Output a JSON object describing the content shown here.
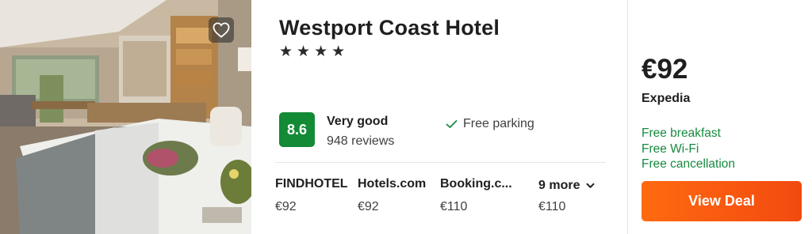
{
  "hotel": {
    "name": "Westport Coast Hotel",
    "stars": [
      "★",
      "★",
      "★",
      "★"
    ]
  },
  "rating": {
    "score": "8.6",
    "label": "Very good",
    "reviews": "948 reviews"
  },
  "amenity": {
    "text": "Free parking"
  },
  "providers": [
    {
      "name": "FINDHOTEL",
      "price": "€92"
    },
    {
      "name": "Hotels.com",
      "price": "€92"
    },
    {
      "name": "Booking.c...",
      "price": "€110"
    }
  ],
  "more": {
    "label": "9 more",
    "price": "€110"
  },
  "deal": {
    "price": "€92",
    "provider": "Expedia",
    "perks": [
      "Free breakfast",
      "Free Wi-Fi",
      "Free cancellation"
    ],
    "button_label": "View Deal"
  },
  "colors": {
    "score_badge": "#138a36",
    "perk_text": "#178a3f",
    "deal_button": "#f25a10"
  },
  "icons": {
    "favorite": "heart-icon",
    "amenity": "check-icon",
    "more": "chevron-down-icon"
  }
}
